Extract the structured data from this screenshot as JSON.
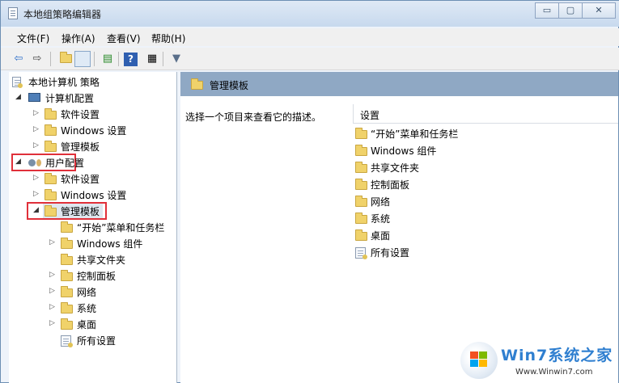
{
  "window": {
    "title": "本地组策略编辑器",
    "minimize": "▭",
    "maximize": "▢",
    "close": "✕"
  },
  "menu": [
    "文件(F)",
    "操作(A)",
    "查看(V)",
    "帮助(H)"
  ],
  "toolbar": {
    "back": "⇦",
    "forward": "⇨",
    "filter": "▼",
    "help": "?"
  },
  "tree": {
    "root": "本地计算机 策略",
    "computer_config": "计算机配置",
    "computer_children": [
      "软件设置",
      "Windows 设置",
      "管理模板"
    ],
    "user_config": "用户配置",
    "user_children": [
      "软件设置",
      "Windows 设置",
      "管理模板"
    ],
    "admin_templates_children": [
      "“开始”菜单和任务栏",
      "Windows 组件",
      "共享文件夹",
      "控制面板",
      "网络",
      "系统",
      "桌面",
      "所有设置"
    ]
  },
  "right": {
    "header": "管理模板",
    "description": "选择一个项目来查看它的描述。",
    "column_header": "设置",
    "items": [
      "“开始”菜单和任务栏",
      "Windows 组件",
      "共享文件夹",
      "控制面板",
      "网络",
      "系统",
      "桌面",
      "所有设置"
    ]
  },
  "watermark": {
    "title": "Win7系统之家",
    "url": "Www.Winwin7.com"
  },
  "colors": {
    "highlight_box": "#e0303a",
    "header_bar": "#8fa8c4",
    "watermark_blue": "#2f7fd0"
  }
}
